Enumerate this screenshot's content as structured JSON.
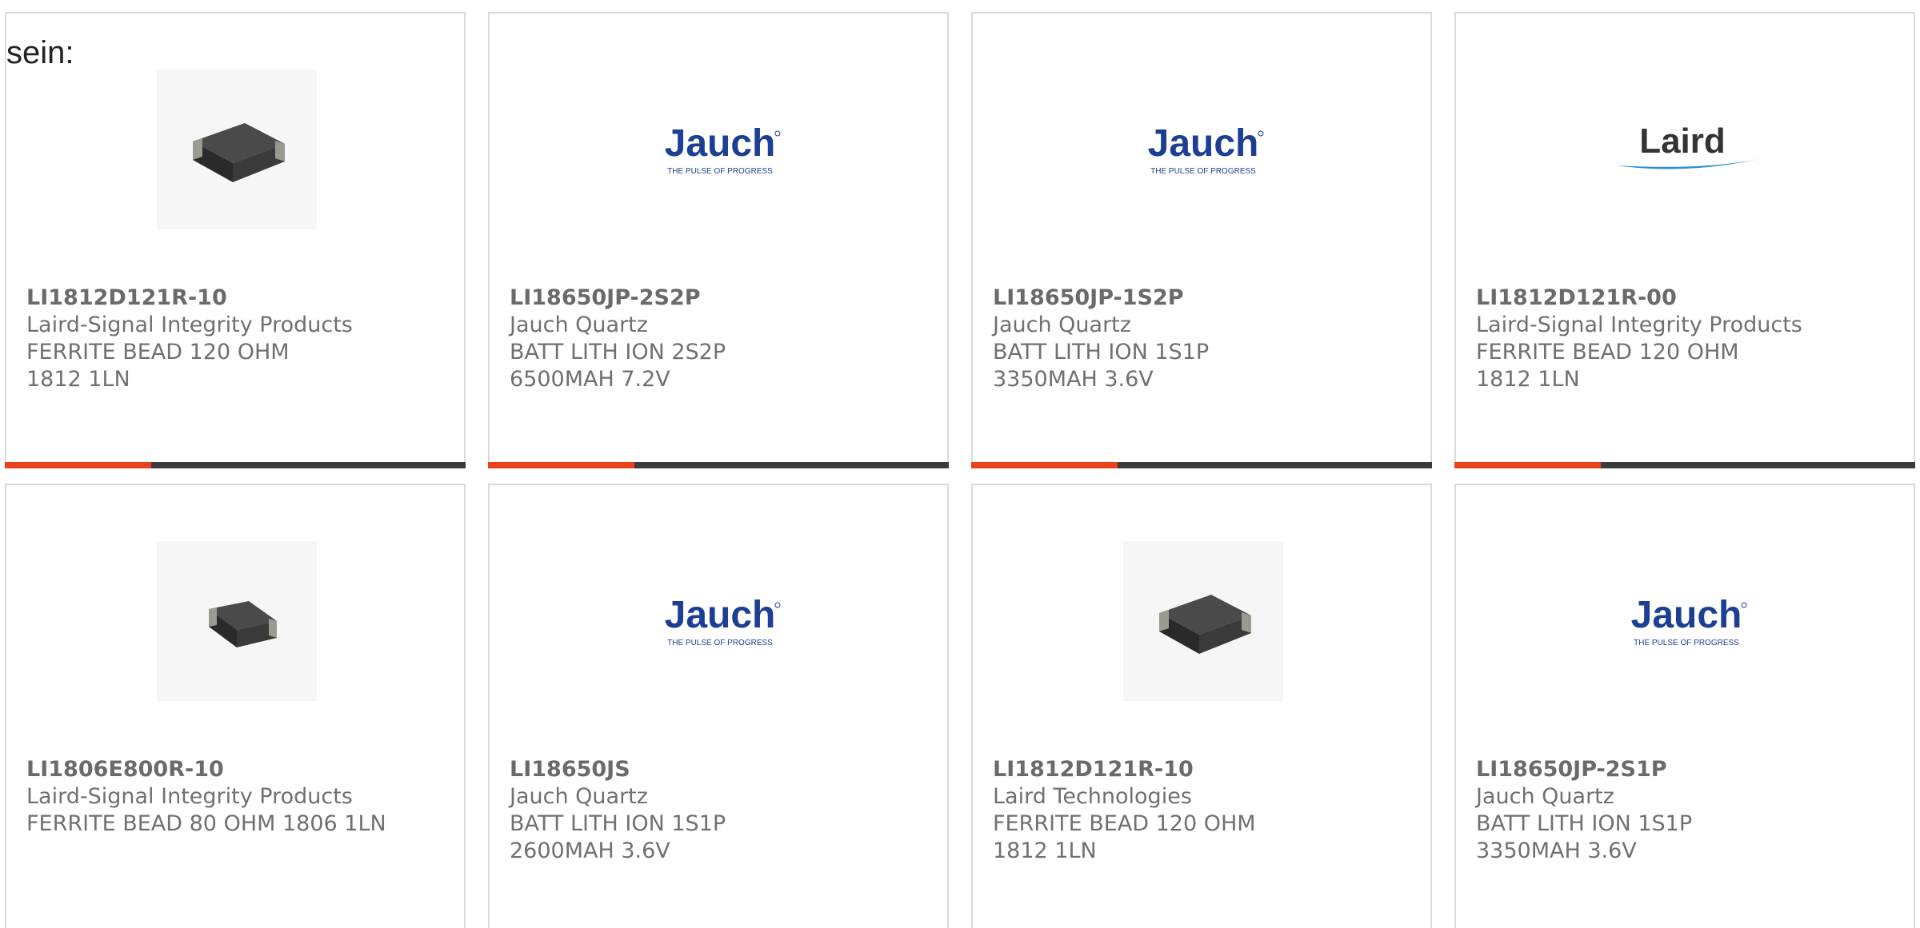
{
  "heading": "sein:",
  "colors": {
    "accent": "#e8411c",
    "bar": "#3b3b3b",
    "card_border": "#dadada",
    "text": "#707070",
    "jauch_blue": "#1c3f94"
  },
  "products": [
    {
      "part": "LI1812D121R-10",
      "manufacturer": "Laird-Signal Integrity Products",
      "description": "FERRITE BEAD 120 OHM 1812 1LN",
      "image": "ferrite-bead-photo"
    },
    {
      "part": "LI18650JP-2S2P",
      "manufacturer": "Jauch Quartz",
      "description": "BATT LITH ION 2S2P 6500MAH 7.2V",
      "image": "jauch-logo"
    },
    {
      "part": "LI18650JP-1S2P",
      "manufacturer": "Jauch Quartz",
      "description": "BATT LITH ION 1S1P 3350MAH 3.6V",
      "image": "jauch-logo"
    },
    {
      "part": "LI1812D121R-00",
      "manufacturer": "Laird-Signal Integrity Products",
      "description": "FERRITE BEAD 120 OHM 1812 1LN",
      "image": "laird-logo"
    },
    {
      "part": "LI1806E800R-10",
      "manufacturer": "Laird-Signal Integrity Products",
      "description": "FERRITE BEAD 80 OHM 1806 1LN",
      "image": "ferrite-bead-photo"
    },
    {
      "part": "LI18650JS",
      "manufacturer": "Jauch Quartz",
      "description": "BATT LITH ION 1S1P 2600MAH 3.6V",
      "image": "jauch-logo"
    },
    {
      "part": "LI1812D121R-10",
      "manufacturer": "Laird Technologies",
      "description": "FERRITE BEAD 120 OHM 1812 1LN",
      "image": "ferrite-bead-photo"
    },
    {
      "part": "LI18650JP-2S1P",
      "manufacturer": "Jauch Quartz",
      "description": "BATT LITH ION 1S1P 3350MAH 3.6V",
      "image": "jauch-logo"
    }
  ],
  "logos": {
    "jauch": {
      "wordmark": "Jauch",
      "tagline": "THE PULSE OF PROGRESS"
    },
    "laird": {
      "wordmark": "Laird"
    }
  }
}
